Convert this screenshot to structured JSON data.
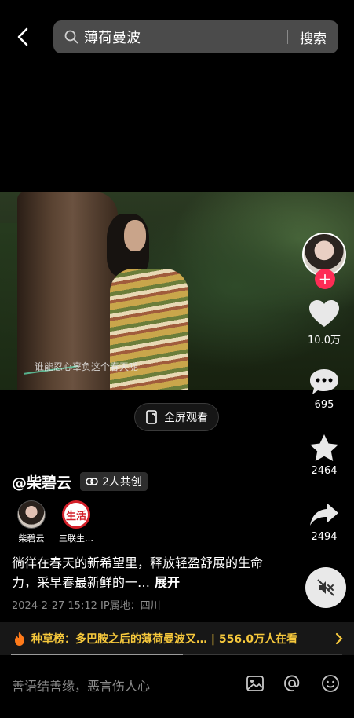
{
  "header": {
    "search_query": "薄荷曼波",
    "search_button_label": "搜索"
  },
  "video": {
    "subtitle": "谁能忍心辜负这个春天呢",
    "fullscreen_label": "全屏观看"
  },
  "sidebar": {
    "follow_symbol": "+",
    "likes": "10.0万",
    "comments": "695",
    "favorites": "2464",
    "shares": "2494"
  },
  "post": {
    "author": "@柴碧云",
    "collab_label": "2人共创",
    "co_creators": [
      {
        "name": "柴碧云"
      },
      {
        "name": "三联生…",
        "badge_text": "生活"
      }
    ],
    "description": "徜徉在春天的新希望里，释放轻盈舒展的生命力，采早春最新鲜的一…",
    "expand_label": "展开",
    "meta": "2024-2-27 15:12  IP属地：四川"
  },
  "trending": {
    "text": "种草榜：多巴胺之后的薄荷曼波又… | 556.0万人在看",
    "progress": 0.52
  },
  "comment_bar": {
    "placeholder": "善语结善缘，恶言伤人心"
  },
  "colors": {
    "accent_red": "#fe2c55",
    "trend_yellow": "#f6c83c"
  },
  "icons": [
    "back-arrow-icon",
    "search-icon",
    "fullscreen-icon",
    "heart-icon",
    "comment-icon",
    "star-icon",
    "share-icon",
    "mute-icon",
    "collab-link-icon",
    "fire-icon",
    "chevron-right-icon",
    "image-icon",
    "at-icon",
    "emoji-icon"
  ]
}
